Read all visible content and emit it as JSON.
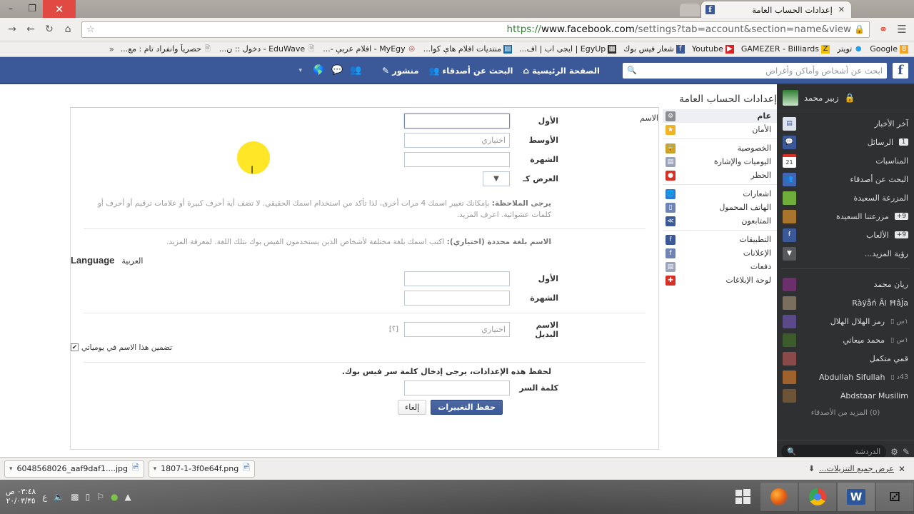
{
  "browser": {
    "tab_title": "إعدادات الحساب العامة",
    "tab_close": "✕",
    "url_scheme": "https://",
    "url_host": "www.facebook.com",
    "url_rest": "/settings?tab=account&section=name&view",
    "lock_icon": "lock-icon",
    "win_minimize": "–",
    "win_maximize": "❐",
    "win_close": "✕",
    "toolbar_icons": [
      "menu-icon",
      "extension-icon",
      "star-icon",
      "home-icon",
      "reload-icon",
      "back-icon",
      "forward-icon"
    ],
    "bookmarks": [
      {
        "label": "Google",
        "color": "#f5a623",
        "glyph": "8"
      },
      {
        "label": "تويتر",
        "color": "#1da1f2",
        "glyph": "🐦"
      },
      {
        "label": "GAMEZER - Billiards",
        "color": "#f2c100",
        "glyph": "Z"
      },
      {
        "label": "Youtube",
        "color": "#e02020",
        "glyph": "▶"
      },
      {
        "label": "شعار فيس بوك",
        "color": "#3b5998",
        "glyph": "f"
      },
      {
        "label": "EgyUp | ايجى اب | اف...",
        "color": "#2b2b2b",
        "glyph": "▦"
      },
      {
        "label": "منتديات افلام هاي كوا...",
        "color": "#1b6ca8",
        "glyph": "▤"
      },
      {
        "label": "MyEgy - افلام عربي -...",
        "color": "#d2232a",
        "glyph": "◒"
      },
      {
        "label": "EduWave - دخول :: ن...",
        "color": "#ffffff",
        "glyph": "🗋"
      },
      {
        "label": "حصرياً وانفراد تام : مع...",
        "color": "#ffffff",
        "glyph": "🗋"
      }
    ],
    "bookmarks_overflow": "«"
  },
  "fb_nav": {
    "logo": "f",
    "search_placeholder": "ابحث عن أشخاص وأماكن وأغراض",
    "search_icon": "search-icon",
    "links": [
      {
        "label": "الصفحة الرئيسية",
        "icon": "home-icon",
        "glyph": "⌂"
      },
      {
        "label": "البحث عن أصدقاء",
        "icon": "friends-icon",
        "glyph": "👥"
      },
      {
        "label": "منشور",
        "icon": "compose-icon",
        "glyph": "✎"
      }
    ],
    "icons": [
      "friend-requests-icon",
      "messages-icon",
      "globe-notifications-icon"
    ],
    "caret": "▾"
  },
  "settings": {
    "page_title": "إعدادات الحساب العامة",
    "menu": [
      [
        {
          "label": "عام",
          "icon": "gear-icon",
          "color": "#8b8d91",
          "glyph": "✿",
          "active": true
        },
        {
          "label": "الأمان",
          "icon": "shield-icon",
          "color": "#f0b323",
          "glyph": "🛡"
        }
      ],
      [
        {
          "label": "الخصوصية",
          "icon": "lock-icon",
          "color": "#c9a227",
          "glyph": "🔒"
        },
        {
          "label": "اليوميات والإشارة",
          "icon": "timeline-icon",
          "color": "#9aa5bd",
          "glyph": "▤"
        },
        {
          "label": "الحظر",
          "icon": "block-icon",
          "color": "#d93025",
          "glyph": "⛔"
        }
      ],
      [
        {
          "label": "اشعارات",
          "icon": "globe-icon",
          "color": "#2f7bd4",
          "glyph": "🌐"
        },
        {
          "label": "الهاتف المحمول",
          "icon": "mobile-icon",
          "color": "#6d84b4",
          "glyph": "▯"
        },
        {
          "label": "المتابعون",
          "icon": "rss-icon",
          "color": "#3b5998",
          "glyph": "≫"
        }
      ],
      [
        {
          "label": "التطبيقات",
          "icon": "apps-icon",
          "color": "#3b5998",
          "glyph": "f"
        },
        {
          "label": "الإعلانات",
          "icon": "ads-icon",
          "color": "#6d84b4",
          "glyph": "f"
        },
        {
          "label": "دفعات",
          "icon": "payments-icon",
          "color": "#9aa5bd",
          "glyph": "▤"
        },
        {
          "label": "لوحة الإبلاغات",
          "icon": "support-icon",
          "color": "#d93025",
          "glyph": "✚"
        }
      ]
    ],
    "name_section_label": "الاسم",
    "name_fields": [
      {
        "label": "الأول",
        "value": "",
        "placeholder": "",
        "focused": true
      },
      {
        "label": "الأوسط",
        "value": "",
        "placeholder": "اختياري",
        "focused": false
      },
      {
        "label": "الشهرة",
        "value": "",
        "placeholder": "",
        "focused": false
      }
    ],
    "show_as_label": "العرض كـ",
    "show_as_value": "",
    "show_as_caret": "▼",
    "note_bold": "يرجى الملاحظة:",
    "note_text": " بإمكانك تغيير اسمك 4 مرات أخرى، لذا تأكد من استخدام اسمك الحقيقي. لا تضف أية أحرف كبيرة أو علامات ترقيم أو أحرف أو كلمات عشوائية.",
    "note_link": " اعرف المزيد.",
    "alt_lang_bold": "الاسم بلغة محددة (اختياري):",
    "alt_lang_text": " اكتب اسمك بلغة مختلفة لأشخاص الذين يستخدمون الفيس بوك بتلك اللغة.",
    "alt_lang_link": " لمعرفة المزيد.",
    "language_title": "Language",
    "language_value": "العربية",
    "language_fields": [
      {
        "label": "الأول",
        "value": "",
        "placeholder": ""
      },
      {
        "label": "الشهرة",
        "value": "",
        "placeholder": ""
      }
    ],
    "alt_name_label": "الاسم البديل",
    "alt_name_placeholder": "اختياري",
    "alt_name_help": "[؟]",
    "checkbox_label": "تضمين هذا الاسم في يومياتي",
    "checkbox_checked": "✔",
    "password_note": "لحفظ هذه الإعدادات، يرجى إدخال كلمة سر فيس بوك.",
    "password_label": "كلمة السر",
    "password_value": "",
    "save_button": "حفظ التغييرات",
    "cancel_button": "إلغاء"
  },
  "right_sidebar": {
    "user_name": "زبير محمد",
    "header_icon": "privacy-shortcuts-icon",
    "shortcuts": [
      {
        "label": "آخر الأخبار",
        "icon": "newsfeed-icon",
        "color": "#e8eaf0",
        "glyph": "▤",
        "badge": ""
      },
      {
        "label": "الرسائل",
        "icon": "messages-icon",
        "color": "#3b5998",
        "glyph": "✉",
        "badge": "1"
      },
      {
        "label": "المناسبات",
        "icon": "events-icon",
        "color": "#d93025",
        "glyph": "21",
        "badge": ""
      },
      {
        "label": "البحث عن أصدقاء",
        "icon": "find-friends-icon",
        "color": "#4267b2",
        "glyph": "👥",
        "badge": ""
      },
      {
        "label": "المزرعة السعيدة",
        "icon": "happy-farm-icon",
        "color": "#6fae3b",
        "glyph": "🌾",
        "badge": ""
      },
      {
        "label": "مزرعتنا السعيدة",
        "icon": "our-farm-icon",
        "color": "#a9742c",
        "glyph": "🐄",
        "badge": "9+"
      },
      {
        "label": "الألعاب",
        "icon": "games-icon",
        "color": "#3b5998",
        "glyph": "f",
        "badge": "9+"
      },
      {
        "label": "رؤية المزيد...",
        "icon": "chevron-down-icon",
        "color": "#56585c",
        "glyph": "▼",
        "badge": ""
      }
    ],
    "contacts": [
      {
        "name": "ريان محمد",
        "color": "#6b2f6b",
        "meta": "",
        "mobile": false
      },
      {
        "name": "Ràÿåń Āl ĦâĴa",
        "color": "#7a6f5e",
        "meta": "",
        "mobile": false
      },
      {
        "name": "رمز الهلال الهلال",
        "color": "#5a4a8a",
        "meta": "١س",
        "mobile": true
      },
      {
        "name": "محمد ميعاتي",
        "color": "#3c5c2c",
        "meta": "١س",
        "mobile": true
      },
      {
        "name": "قمي متكمل",
        "color": "#8a4a4a",
        "meta": "",
        "mobile": false
      },
      {
        "name": "Abdullah Sifullah",
        "color": "#a0622c",
        "meta": "43د",
        "mobile": true
      },
      {
        "name": "Abdstaar Musilim",
        "color": "#6e5436",
        "meta": "",
        "mobile": false
      }
    ],
    "more_friends": "(0) المزيد من الأصدقاء",
    "chat_placeholder": "الدردشة",
    "chat_search_icon": "search-icon",
    "chat_compose_icon": "compose-icon",
    "chat_settings_icon": "gear-icon"
  },
  "downloads": {
    "items": [
      {
        "name": "6048568026_aaf9daf1....jpg",
        "icon": "image-file-icon",
        "caret": "▾"
      },
      {
        "name": "1807-1-3f0e64f.png",
        "icon": "image-file-icon",
        "caret": "▾"
      }
    ],
    "show_all": "عرض جميع التنزيلات...",
    "download_icon": "download-arrow-icon",
    "close": "✕"
  },
  "taskbar": {
    "apps": [
      {
        "name": "windows-start-icon",
        "glyph": "⊞"
      },
      {
        "name": "firefox-icon",
        "glyph": "🦊"
      },
      {
        "name": "chrome-icon",
        "glyph": "◉"
      },
      {
        "name": "word-icon",
        "glyph": "W"
      },
      {
        "name": "dice-app-icon",
        "glyph": "🎲"
      }
    ],
    "tray": [
      "show-hidden-icons",
      "shield-icon",
      "flag-icon",
      "battery-icon",
      "network-icon",
      "volume-icon"
    ],
    "tray_lang": "ع",
    "clock_time": "٠٣:٤٨ ص",
    "clock_date": "٢٠/٠٣/٣٥"
  }
}
